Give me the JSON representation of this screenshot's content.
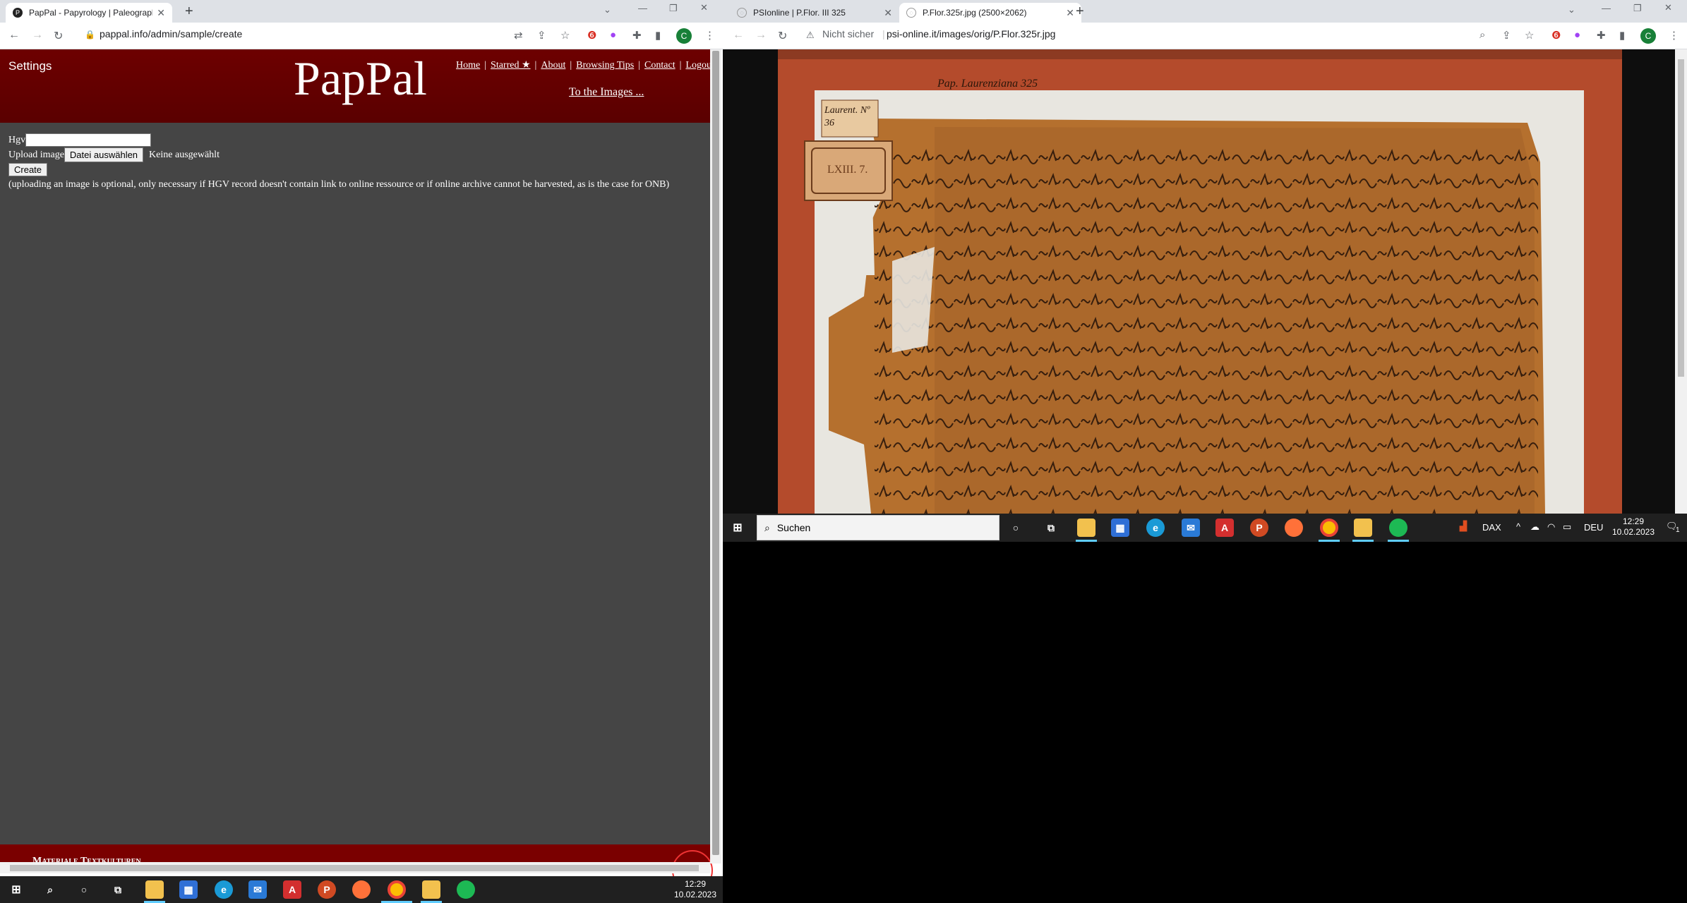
{
  "left_browser": {
    "tabs": [
      {
        "title": "PapPal - Papyrology | Paleograph",
        "active": true
      }
    ],
    "url": "pappal.info/admin/sample/create"
  },
  "pappal": {
    "settings": "Settings",
    "logo": "PapPal",
    "nav": [
      "Home",
      "Starred ★",
      "About",
      "Browsing Tips",
      "Contact",
      "Logou"
    ],
    "nav_separator": "|",
    "to_images": "To the Images ...",
    "form": {
      "hgv_label": "Hgv",
      "hgv_value": "",
      "upload_label": "Upload image",
      "file_button": "Datei auswählen",
      "file_status": "Keine ausgewählt",
      "create_button": "Create",
      "note": "(uploading an image is optional, only necessary if HGV record doesn't contain link to online ressource or if online archive cannot be harvested, as is the case for ONB)"
    },
    "footer": "Materiale Textkulturen"
  },
  "right_browser": {
    "tabs": [
      {
        "title": "PSIonline | P.Flor. III 325",
        "active": false
      },
      {
        "title": "P.Flor.325r.jpg (2500×2062)",
        "active": true
      }
    ],
    "security_label": "Nicht sicher",
    "url": "psi-online.it/images/orig/P.Flor.325r.jpg",
    "image_labels": {
      "ruler": "Pap. Laurenziana 325",
      "tag_top": "Laurent. Nº 36",
      "tag_bottom": "LXIII. 7."
    }
  },
  "taskbar_left": {
    "time": "12:29",
    "date": "10.02.2023"
  },
  "taskbar_right": {
    "search_placeholder": "Suchen",
    "dax": "DAX",
    "lang": "DEU",
    "time": "12:29",
    "date": "10.02.2023",
    "notification_count": "1"
  },
  "colors": {
    "header": "#6d0000",
    "body": "#454545",
    "taskbar": "#202020",
    "papyrus": "#b5702e"
  }
}
